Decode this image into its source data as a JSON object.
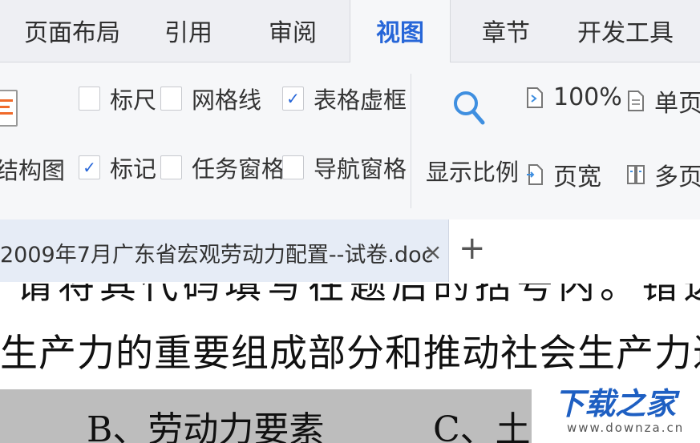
{
  "ribbon_tabs": [
    {
      "label": "页面布局"
    },
    {
      "label": "引用"
    },
    {
      "label": "审阅"
    },
    {
      "label": "视图",
      "active": true
    },
    {
      "label": "章节"
    },
    {
      "label": "开发工具"
    }
  ],
  "ribbon": {
    "structure_button": {
      "label": "结构图",
      "icon": "document-outline-icon"
    },
    "checkboxes": [
      {
        "label": "标尺",
        "checked": false
      },
      {
        "label": "网格线",
        "checked": false
      },
      {
        "label": "表格虚框",
        "checked": true
      },
      {
        "label": "标记",
        "checked": true
      },
      {
        "label": "任务窗格",
        "checked": false
      },
      {
        "label": "导航窗格",
        "checked": false
      }
    ],
    "check_glyph": "✓",
    "zoom_button": {
      "label": "显示比例",
      "icon": "magnifier-icon"
    },
    "zoom_100": {
      "label": "100%",
      "icon": "zoom-100-icon"
    },
    "page_width": {
      "label": "页宽",
      "icon": "page-width-icon"
    },
    "single_page": {
      "label": "单页",
      "icon": "single-page-icon"
    },
    "multi_page": {
      "label": "多页",
      "icon": "multi-page-icon"
    }
  },
  "document_tab": {
    "title": "2009年7月广东省宏观劳动力配置--试卷.doc",
    "close_glyph": "×",
    "new_tab_glyph": "+"
  },
  "document": {
    "partial_line": "请将其代码填写在题后的括号内。错选、多",
    "line": "生产力的重要组成部分和推动社会生产力进步",
    "option_b": "B、劳动力要素",
    "option_c": "C、土地"
  },
  "watermark": {
    "text": "下载之家",
    "url": "www.downza.cn"
  },
  "colors": {
    "accent": "#2766d8",
    "ribbon_bg": "#f6f7f9",
    "tabbar_bg": "#eeeff3",
    "doc_tab_bg": "#e6ecf6",
    "gray_band": "#bdbdbd",
    "watermark_blue": "#1e5fc2"
  }
}
